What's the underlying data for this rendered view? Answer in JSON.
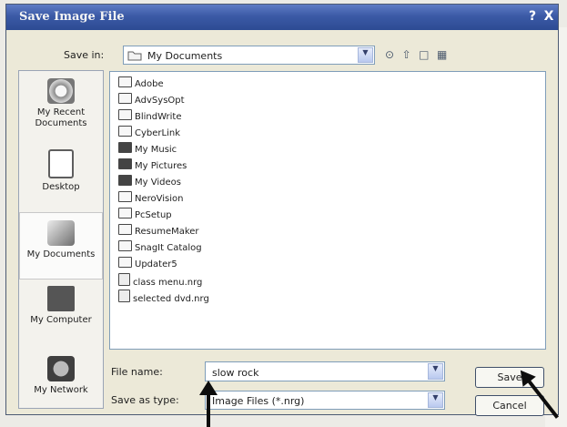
{
  "dialog": {
    "title": "Save Image File",
    "help": "?",
    "close": "X"
  },
  "save_in": {
    "label": "Save in:",
    "value": "My Documents"
  },
  "places": [
    {
      "label": "My Recent Documents"
    },
    {
      "label": "Desktop"
    },
    {
      "label": "My Documents"
    },
    {
      "label": "My Computer"
    },
    {
      "label": "My Network"
    }
  ],
  "files": [
    "Adobe",
    "AdvSysOpt",
    "BlindWrite",
    "CyberLink",
    "My Music",
    "My Pictures",
    "My Videos",
    "NeroVision",
    "PcSetup",
    "ResumeMaker",
    "SnagIt Catalog",
    "Updater5",
    "class menu.nrg",
    "selected dvd.nrg"
  ],
  "file_name": {
    "label": "File name:",
    "value": "slow rock"
  },
  "save_as_type": {
    "label": "Save as type:",
    "value": "Image Files (*.nrg)"
  },
  "buttons": {
    "save": "Save",
    "cancel": "Cancel"
  }
}
